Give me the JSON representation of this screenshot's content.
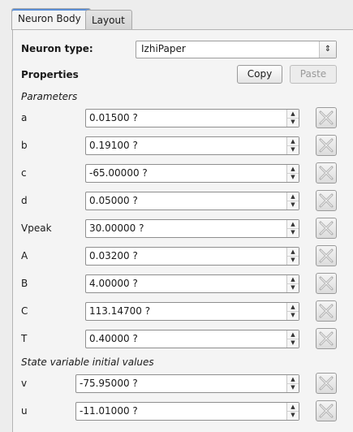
{
  "tabs": [
    {
      "label": "Neuron Body",
      "active": true
    },
    {
      "label": "Layout",
      "active": false
    }
  ],
  "neuron_type": {
    "label": "Neuron type:",
    "value": "IzhiPaper"
  },
  "properties": {
    "label": "Properties",
    "copy_label": "Copy",
    "paste_label": "Paste"
  },
  "parameters": {
    "heading": "Parameters",
    "items": [
      {
        "name": "a",
        "value": "0.01500 ?"
      },
      {
        "name": "b",
        "value": "0.19100 ?"
      },
      {
        "name": "c",
        "value": "-65.00000 ?"
      },
      {
        "name": "d",
        "value": "0.05000 ?"
      },
      {
        "name": "Vpeak",
        "value": "30.00000 ?"
      },
      {
        "name": "A",
        "value": "0.03200 ?"
      },
      {
        "name": "B",
        "value": "4.00000 ?"
      },
      {
        "name": "C",
        "value": "113.14700 ?"
      },
      {
        "name": "T",
        "value": "0.40000 ?"
      }
    ]
  },
  "state_variables": {
    "heading": "State variable initial values",
    "items": [
      {
        "name": "v",
        "value": "-75.95000 ?"
      },
      {
        "name": "u",
        "value": "-11.01000 ?"
      }
    ]
  }
}
